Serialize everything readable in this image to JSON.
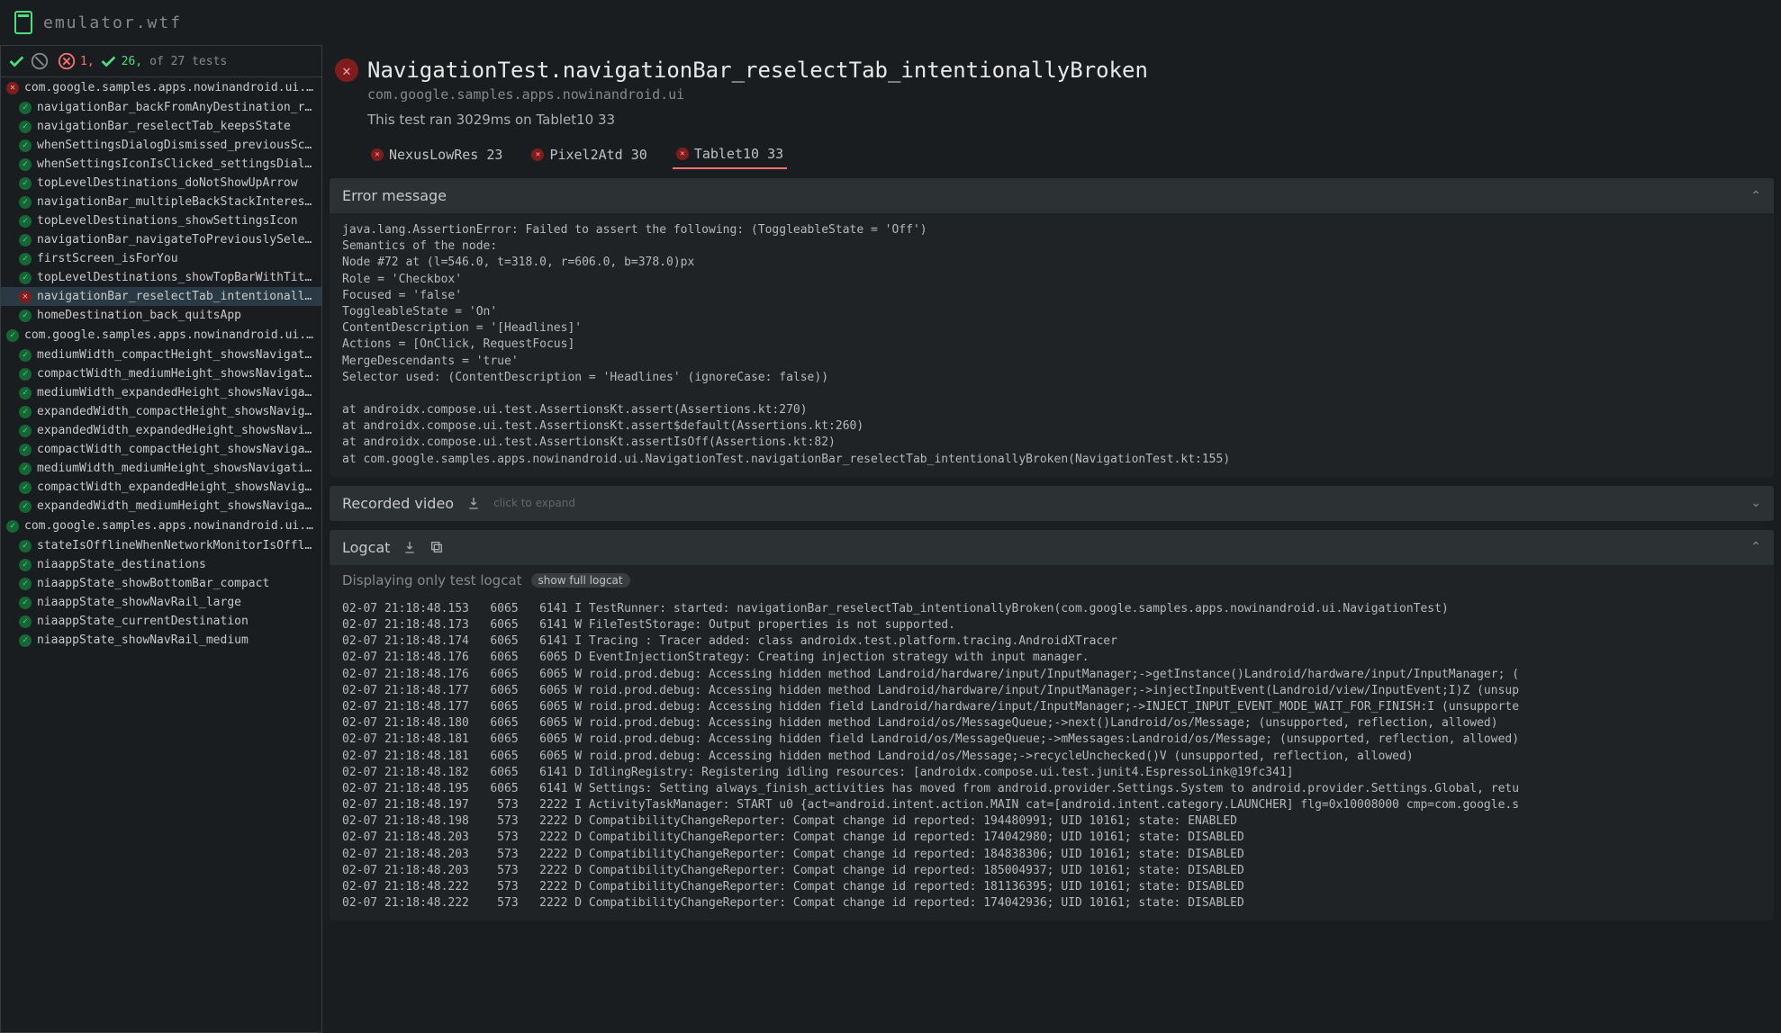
{
  "brand": "emulator.wtf",
  "summary": {
    "fail_count": "1,",
    "pass_count": "26,",
    "total_suffix": " of 27 tests"
  },
  "groups": [
    {
      "status": "fail",
      "label": "com.google.samples.apps.nowinandroid.ui.Naviga…"
    },
    {
      "status": "pass",
      "label": "com.google.samples.apps.nowinandroid.ui.Naviga…"
    },
    {
      "status": "pass",
      "label": "com.google.samples.apps.nowinandroid.ui.NiaApp…"
    }
  ],
  "tests_g0": [
    {
      "status": "pass",
      "label": "navigationBar_backFromAnyDestination_retur…"
    },
    {
      "status": "pass",
      "label": "navigationBar_reselectTab_keepsState"
    },
    {
      "status": "pass",
      "label": "whenSettingsDialogDismissed_previousScreen…"
    },
    {
      "status": "pass",
      "label": "whenSettingsIconIsClicked_settingsDialogIsSh…"
    },
    {
      "status": "pass",
      "label": "topLevelDestinations_doNotShowUpArrow"
    },
    {
      "status": "pass",
      "label": "navigationBar_multipleBackStackInterests"
    },
    {
      "status": "pass",
      "label": "topLevelDestinations_showSettingsIcon"
    },
    {
      "status": "pass",
      "label": "navigationBar_navigateToPreviouslySelectedTa…"
    },
    {
      "status": "pass",
      "label": "firstScreen_isForYou"
    },
    {
      "status": "pass",
      "label": "topLevelDestinations_showTopBarWithTitle"
    },
    {
      "status": "fail",
      "label": "navigationBar_reselectTab_intentionallyBroken",
      "selected": true
    },
    {
      "status": "pass",
      "label": "homeDestination_back_quitsApp"
    }
  ],
  "tests_g1": [
    {
      "status": "pass",
      "label": "mediumWidth_compactHeight_showsNavigati…"
    },
    {
      "status": "pass",
      "label": "compactWidth_mediumHeight_showsNavigati…"
    },
    {
      "status": "pass",
      "label": "mediumWidth_expandedHeight_showsNaviga…"
    },
    {
      "status": "pass",
      "label": "expandedWidth_compactHeight_showsNaviga…"
    },
    {
      "status": "pass",
      "label": "expandedWidth_expandedHeight_showsNavig…"
    },
    {
      "status": "pass",
      "label": "compactWidth_compactHeight_showsNavigati…"
    },
    {
      "status": "pass",
      "label": "mediumWidth_mediumHeight_showsNavigatio…"
    },
    {
      "status": "pass",
      "label": "compactWidth_expandedHeight_showsNaviga…"
    },
    {
      "status": "pass",
      "label": "expandedWidth_mediumHeight_showsNavigat…"
    }
  ],
  "tests_g2": [
    {
      "status": "pass",
      "label": "stateIsOfflineWhenNetworkMonitorIsOffline"
    },
    {
      "status": "pass",
      "label": "niaappState_destinations"
    },
    {
      "status": "pass",
      "label": "niaappState_showBottomBar_compact"
    },
    {
      "status": "pass",
      "label": "niaappState_showNavRail_large"
    },
    {
      "status": "pass",
      "label": "niaappState_currentDestination"
    },
    {
      "status": "pass",
      "label": "niaappState_showNavRail_medium"
    }
  ],
  "detail": {
    "title": "NavigationTest.navigationBar_reselectTab_intentionallyBroken",
    "package": "com.google.samples.apps.nowinandroid.ui",
    "run_info": "This test ran 3029ms on Tablet10 33"
  },
  "devices": [
    {
      "label": "NexusLowRes 23",
      "active": false
    },
    {
      "label": "Pixel2Atd 30",
      "active": false
    },
    {
      "label": "Tablet10 33",
      "active": true
    }
  ],
  "panels": {
    "error_title": "Error message",
    "video_title": "Recorded video",
    "video_hint": "click to expand",
    "logcat_title": "Logcat",
    "logcat_pre": "Displaying only test logcat",
    "logcat_pill": "show full logcat"
  },
  "error_body": "java.lang.AssertionError: Failed to assert the following: (ToggleableState = 'Off')\nSemantics of the node:\nNode #72 at (l=546.0, t=318.0, r=606.0, b=378.0)px\nRole = 'Checkbox'\nFocused = 'false'\nToggleableState = 'On'\nContentDescription = '[Headlines]'\nActions = [OnClick, RequestFocus]\nMergeDescendants = 'true'\nSelector used: (ContentDescription = 'Headlines' (ignoreCase: false))\n\nat androidx.compose.ui.test.AssertionsKt.assert(Assertions.kt:270)\nat androidx.compose.ui.test.AssertionsKt.assert$default(Assertions.kt:260)\nat androidx.compose.ui.test.AssertionsKt.assertIsOff(Assertions.kt:82)\nat com.google.samples.apps.nowinandroid.ui.NavigationTest.navigationBar_reselectTab_intentionallyBroken(NavigationTest.kt:155)",
  "logcat_body": "02-07 21:18:48.153   6065   6141 I TestRunner: started: navigationBar_reselectTab_intentionallyBroken(com.google.samples.apps.nowinandroid.ui.NavigationTest)\n02-07 21:18:48.173   6065   6141 W FileTestStorage: Output properties is not supported.\n02-07 21:18:48.174   6065   6141 I Tracing : Tracer added: class androidx.test.platform.tracing.AndroidXTracer\n02-07 21:18:48.176   6065   6065 D EventInjectionStrategy: Creating injection strategy with input manager.\n02-07 21:18:48.176   6065   6065 W roid.prod.debug: Accessing hidden method Landroid/hardware/input/InputManager;->getInstance()Landroid/hardware/input/InputManager; (\n02-07 21:18:48.177   6065   6065 W roid.prod.debug: Accessing hidden method Landroid/hardware/input/InputManager;->injectInputEvent(Landroid/view/InputEvent;I)Z (unsup\n02-07 21:18:48.177   6065   6065 W roid.prod.debug: Accessing hidden field Landroid/hardware/input/InputManager;->INJECT_INPUT_EVENT_MODE_WAIT_FOR_FINISH:I (unsupporte\n02-07 21:18:48.180   6065   6065 W roid.prod.debug: Accessing hidden method Landroid/os/MessageQueue;->next()Landroid/os/Message; (unsupported, reflection, allowed)\n02-07 21:18:48.181   6065   6065 W roid.prod.debug: Accessing hidden field Landroid/os/MessageQueue;->mMessages:Landroid/os/Message; (unsupported, reflection, allowed)\n02-07 21:18:48.181   6065   6065 W roid.prod.debug: Accessing hidden method Landroid/os/Message;->recycleUnchecked()V (unsupported, reflection, allowed)\n02-07 21:18:48.182   6065   6141 D IdlingRegistry: Registering idling resources: [androidx.compose.ui.test.junit4.EspressoLink@19fc341]\n02-07 21:18:48.195   6065   6141 W Settings: Setting always_finish_activities has moved from android.provider.Settings.System to android.provider.Settings.Global, retu\n02-07 21:18:48.197    573   2222 I ActivityTaskManager: START u0 {act=android.intent.action.MAIN cat=[android.intent.category.LAUNCHER] flg=0x10008000 cmp=com.google.s\n02-07 21:18:48.198    573   2222 D CompatibilityChangeReporter: Compat change id reported: 194480991; UID 10161; state: ENABLED\n02-07 21:18:48.203    573   2222 D CompatibilityChangeReporter: Compat change id reported: 174042980; UID 10161; state: DISABLED\n02-07 21:18:48.203    573   2222 D CompatibilityChangeReporter: Compat change id reported: 184838306; UID 10161; state: DISABLED\n02-07 21:18:48.203    573   2222 D CompatibilityChangeReporter: Compat change id reported: 185004937; UID 10161; state: DISABLED\n02-07 21:18:48.222    573   2222 D CompatibilityChangeReporter: Compat change id reported: 181136395; UID 10161; state: DISABLED\n02-07 21:18:48.222    573   2222 D CompatibilityChangeReporter: Compat change id reported: 174042936; UID 10161; state: DISABLED"
}
